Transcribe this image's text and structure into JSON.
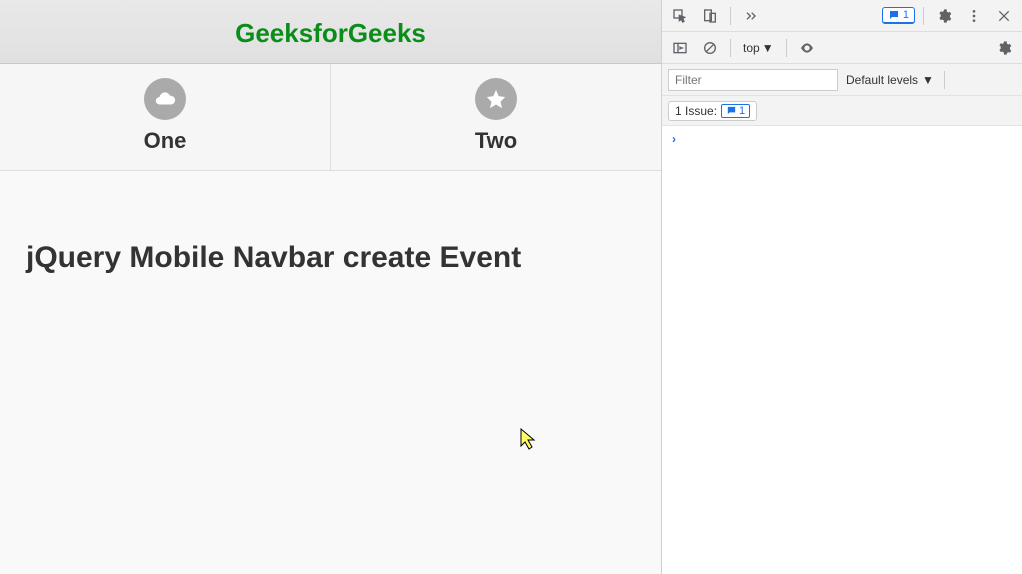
{
  "page": {
    "header_title": "GeeksforGeeks",
    "navbar": [
      {
        "label": "One",
        "icon": "cloud-icon"
      },
      {
        "label": "Two",
        "icon": "star-icon"
      }
    ],
    "content_heading": "jQuery Mobile Navbar create Event"
  },
  "devtools": {
    "message_count": "1",
    "context": "top",
    "filter_placeholder": "Filter",
    "levels_label": "Default levels",
    "issues_label": "1 Issue:",
    "issues_count": "1",
    "prompt": "›"
  }
}
